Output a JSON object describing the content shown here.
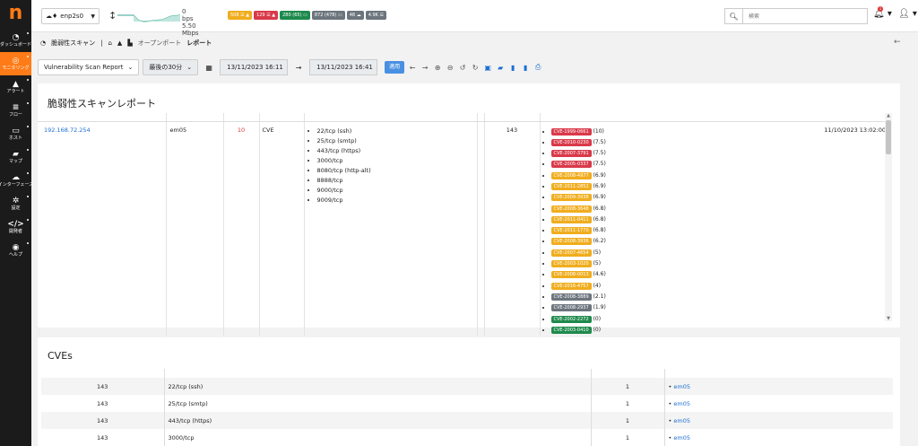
{
  "app": {
    "logo": "n"
  },
  "sidebar": {
    "items": [
      {
        "icon": "dashboard-icon",
        "glyph": "◔",
        "label": "ダッシュボード"
      },
      {
        "icon": "monitoring-icon",
        "glyph": "◎",
        "label": "モニタリング",
        "active": true
      },
      {
        "icon": "alert-icon",
        "glyph": "▲",
        "label": "アラート"
      },
      {
        "icon": "flow-icon",
        "glyph": "≡",
        "label": "フロー"
      },
      {
        "icon": "host-icon",
        "glyph": "▭",
        "label": "ホスト"
      },
      {
        "icon": "map-icon",
        "glyph": "▰",
        "label": "マップ"
      },
      {
        "icon": "interface-icon",
        "glyph": "☁",
        "label": "インターフェース"
      },
      {
        "icon": "settings-icon",
        "glyph": "✲",
        "label": "設定"
      },
      {
        "icon": "developer-icon",
        "glyph": "</>",
        "label": "開発者"
      },
      {
        "icon": "help-icon",
        "glyph": "◉",
        "label": "ヘルプ"
      }
    ]
  },
  "topbar": {
    "interface": "enp2s0",
    "rate_up": "0 bps",
    "rate_down": "5.50 Mbps",
    "badges": [
      {
        "text": "508 ☰ ▲",
        "color": "#f0ad1e"
      },
      {
        "text": "129 ☰ ▲",
        "color": "#d9394a"
      },
      {
        "text": "280 (65) ▭",
        "color": "#1e8a4c"
      },
      {
        "text": "872 (478) ▭",
        "color": "#6c757d"
      },
      {
        "text": "48 ☁",
        "color": "#6c757d"
      },
      {
        "text": "4.9K ☰",
        "color": "#6c757d"
      }
    ],
    "search_placeholder": "検索"
  },
  "breadcrumb": {
    "section": "脆弱性スキャン",
    "link": "オープンポート",
    "current": "レポート"
  },
  "toolbar": {
    "report_select": "Vulnerability Scan Report",
    "range_select": "最後の30分",
    "from": "13/11/2023 16:11",
    "to": "13/11/2023 16:41",
    "apply": "適用"
  },
  "report": {
    "title": "脆弱性スキャンレポート",
    "row": {
      "host": "192.168.72.254",
      "name": "em05",
      "count": "10",
      "type": "CVE",
      "ports": [
        "22/tcp (ssh)",
        "25/tcp (smtp)",
        "443/tcp (https)",
        "3000/tcp",
        "8080/tcp (http-alt)",
        "8888/tcp",
        "9000/tcp",
        "9009/tcp"
      ],
      "cve_count": "143",
      "date": "11/10/2023 13:02:00",
      "cves": [
        {
          "id": "CVE-1999-0661",
          "score": "(10)",
          "color": "#d9394a"
        },
        {
          "id": "CVE-2010-0230",
          "score": "(7.5)",
          "color": "#d9394a"
        },
        {
          "id": "CVE-2007-3791",
          "score": "(7.5)",
          "color": "#d9394a"
        },
        {
          "id": "CVE-2005-0337",
          "score": "(7.5)",
          "color": "#d9394a"
        },
        {
          "id": "CVE-2008-4977",
          "score": "(6.9)",
          "color": "#f0ad1e"
        },
        {
          "id": "CVE-2011-2852",
          "score": "(6.9)",
          "color": "#f0ad1e"
        },
        {
          "id": "CVE-2009-3938",
          "score": "(6.9)",
          "color": "#f0ad1e"
        },
        {
          "id": "CVE-2008-3648",
          "score": "(6.8)",
          "color": "#f0ad1e"
        },
        {
          "id": "CVE-2011-0411",
          "score": "(6.8)",
          "color": "#f0ad1e"
        },
        {
          "id": "CVE-2011-1770",
          "score": "(6.8)",
          "color": "#f0ad1e"
        },
        {
          "id": "CVE-2008-3936",
          "score": "(6.2)",
          "color": "#f0ad1e"
        },
        {
          "id": "CVE-2007-4654",
          "score": "(5)",
          "color": "#f0ad1e"
        },
        {
          "id": "CVE-2003-1020",
          "score": "(5)",
          "color": "#f0ad1e"
        },
        {
          "id": "CVE-2008-0013",
          "score": "(4.6)",
          "color": "#f0ad1e"
        },
        {
          "id": "CVE-2016-4757",
          "score": "(4)",
          "color": "#f0ad1e"
        },
        {
          "id": "CVE-2008-3889",
          "score": "(2.1)",
          "color": "#6c757d"
        },
        {
          "id": "CVE-2008-2937",
          "score": "(1.9)",
          "color": "#6c757d"
        },
        {
          "id": "CVE-2002-2272",
          "score": "(0)",
          "color": "#1e8a4c"
        },
        {
          "id": "CVE-2003-0410",
          "score": "(0)",
          "color": "#1e8a4c"
        }
      ]
    }
  },
  "cves_card": {
    "title": "CVEs",
    "rows": [
      {
        "count": "143",
        "port": "22/tcp (ssh)",
        "n": "1",
        "host": "em05"
      },
      {
        "count": "143",
        "port": "25/tcp (smtp)",
        "n": "1",
        "host": "em05"
      },
      {
        "count": "143",
        "port": "443/tcp (https)",
        "n": "1",
        "host": "em05"
      },
      {
        "count": "143",
        "port": "3000/tcp",
        "n": "1",
        "host": "em05"
      }
    ]
  }
}
